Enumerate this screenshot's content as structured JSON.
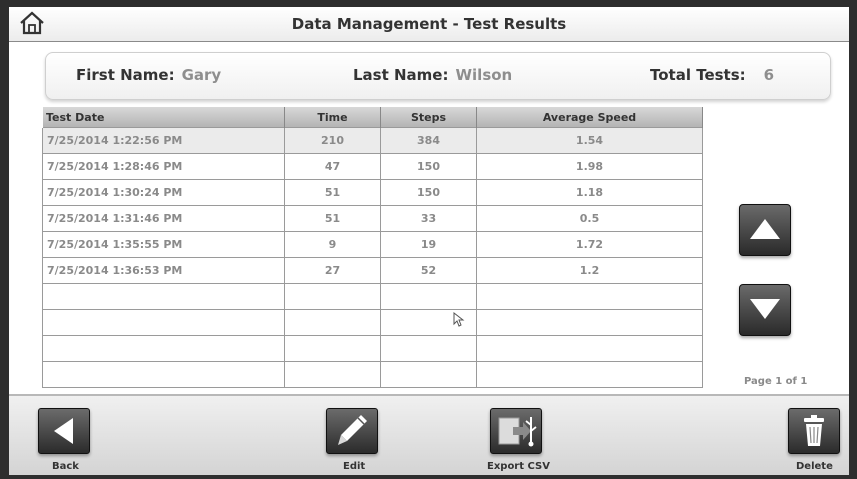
{
  "header": {
    "title": "Data Management - Test Results"
  },
  "info": {
    "first_name_label": "First Name:",
    "first_name_value": "Gary",
    "last_name_label": "Last Name:",
    "last_name_value": "Wilson",
    "total_tests_label": "Total Tests:",
    "total_tests_value": "6"
  },
  "table": {
    "columns": [
      "Test Date",
      "Time",
      "Steps",
      "Average Speed"
    ],
    "rows": [
      [
        "7/25/2014 1:22:56 PM",
        "210",
        "384",
        "1.54"
      ],
      [
        "7/25/2014 1:28:46 PM",
        "47",
        "150",
        "1.98"
      ],
      [
        "7/25/2014 1:30:24 PM",
        "51",
        "150",
        "1.18"
      ],
      [
        "7/25/2014 1:31:46 PM",
        "51",
        "33",
        "0.5"
      ],
      [
        "7/25/2014 1:35:55 PM",
        "9",
        "19",
        "1.72"
      ],
      [
        "7/25/2014 1:36:53 PM",
        "27",
        "52",
        "1.2"
      ]
    ]
  },
  "pagination": {
    "label": "Page 1 of 1"
  },
  "footer": {
    "back_label": "Back",
    "edit_label": "Edit",
    "export_label": "Export CSV",
    "delete_label": "Delete"
  },
  "icons": {
    "home": "home-icon",
    "up": "triangle-up-icon",
    "down": "triangle-down-icon",
    "back": "triangle-left-icon",
    "edit": "pencil-icon",
    "export": "usb-export-icon",
    "delete": "trash-icon"
  }
}
